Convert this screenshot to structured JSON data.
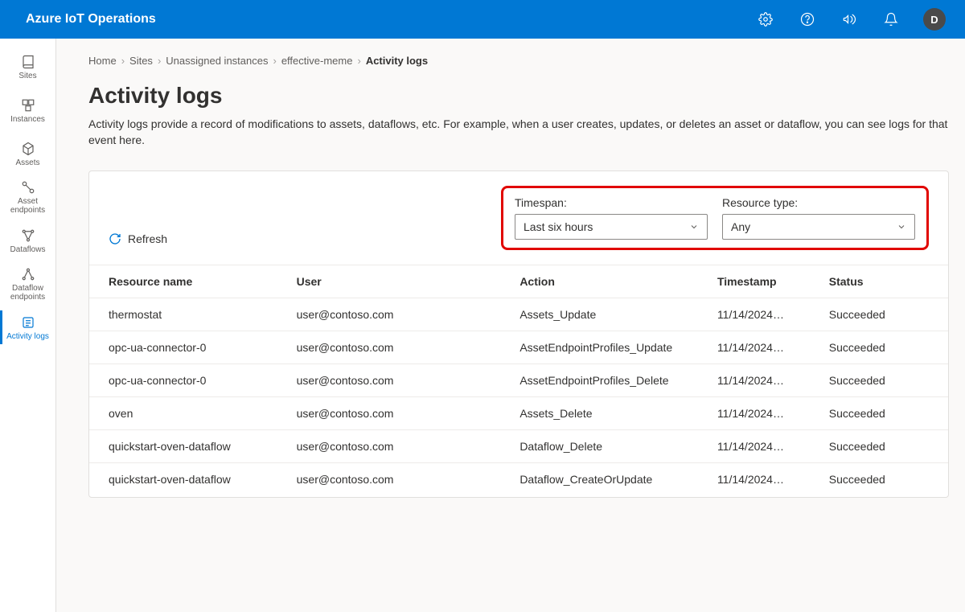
{
  "header": {
    "product": "Azure IoT Operations",
    "avatar_initial": "D"
  },
  "sidebar": {
    "items": [
      {
        "label": "Sites"
      },
      {
        "label": "Instances"
      },
      {
        "label": "Assets"
      },
      {
        "label": "Asset endpoints"
      },
      {
        "label": "Dataflows"
      },
      {
        "label": "Dataflow endpoints"
      },
      {
        "label": "Activity logs"
      }
    ]
  },
  "breadcrumb": {
    "items": [
      "Home",
      "Sites",
      "Unassigned instances",
      "effective-meme",
      "Activity logs"
    ]
  },
  "page": {
    "title": "Activity logs",
    "description": "Activity logs provide a record of modifications to assets, dataflows, etc. For example, when a user creates, updates, or deletes an asset or dataflow, you can see logs for that event here."
  },
  "toolbar": {
    "refresh_label": "Refresh",
    "timespan_label": "Timespan:",
    "timespan_value": "Last six hours",
    "resource_type_label": "Resource type:",
    "resource_type_value": "Any"
  },
  "table": {
    "columns": [
      "Resource name",
      "User",
      "Action",
      "Timestamp",
      "Status"
    ],
    "rows": [
      {
        "resource": "thermostat",
        "user": "user@contoso.com",
        "action": "Assets_Update",
        "timestamp": "11/14/2024…",
        "status": "Succeeded"
      },
      {
        "resource": "opc-ua-connector-0",
        "user": "user@contoso.com",
        "action": "AssetEndpointProfiles_Update",
        "timestamp": "11/14/2024…",
        "status": "Succeeded"
      },
      {
        "resource": "opc-ua-connector-0",
        "user": "user@contoso.com",
        "action": "AssetEndpointProfiles_Delete",
        "timestamp": "11/14/2024…",
        "status": "Succeeded"
      },
      {
        "resource": "oven",
        "user": "user@contoso.com",
        "action": "Assets_Delete",
        "timestamp": "11/14/2024…",
        "status": "Succeeded"
      },
      {
        "resource": "quickstart-oven-dataflow",
        "user": "user@contoso.com",
        "action": "Dataflow_Delete",
        "timestamp": "11/14/2024…",
        "status": "Succeeded"
      },
      {
        "resource": "quickstart-oven-dataflow",
        "user": "user@contoso.com",
        "action": "Dataflow_CreateOrUpdate",
        "timestamp": "11/14/2024…",
        "status": "Succeeded"
      }
    ]
  }
}
